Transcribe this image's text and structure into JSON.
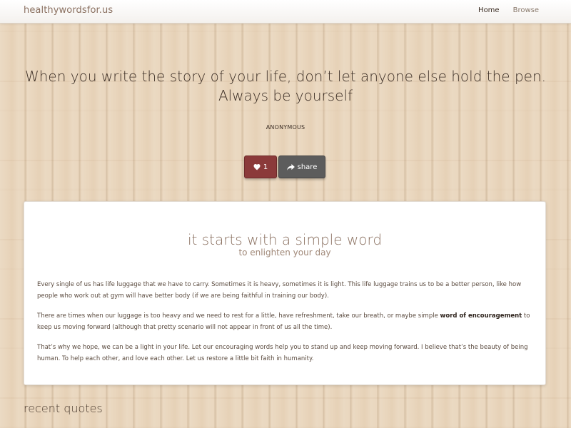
{
  "navbar": {
    "brand": "healthywordsfor.us",
    "links": [
      {
        "label": "Home",
        "active": true
      },
      {
        "label": "Browse",
        "active": false
      }
    ]
  },
  "quote": {
    "text": "When you write the story of your life, don’t let anyone else hold the pen. Always be yourself",
    "author": "ANONYMOUS",
    "like_count": "1",
    "share_label": "share"
  },
  "intro": {
    "title": "it starts with a simple word",
    "subtitle": "to enlighten your day",
    "paragraph1": "Every single of us has life luggage that we have to carry. Sometimes it is heavy, sometimes it is light. This life luggage trains us to be a better person, like how people who work out at gym will have better body (if we are being faithful in training our body).",
    "paragraph2_before": "There are times when our luggage is too heavy and we need to rest for a little, have refreshment, take our breath, or maybe simple ",
    "paragraph2_bold": "word of encouragement",
    "paragraph2_after": " to keep us moving forward (although that pretty scenario will not appear in front of us all the time).",
    "paragraph3": "That’s why we hope, we can be a light in your life. Let our encouraging words help you to stand up and keep moving forward. I believe that’s the beauty of being human. To help each other, and love each other. Let us restore a little bit faith in humanity."
  },
  "recent": {
    "heading": "recent quotes"
  },
  "colors": {
    "like_button": "#8b3a3a",
    "share_button": "#5c5c5c",
    "brand_text": "#8a7060"
  },
  "icons": [
    "heart-icon",
    "share-arrow-icon"
  ]
}
